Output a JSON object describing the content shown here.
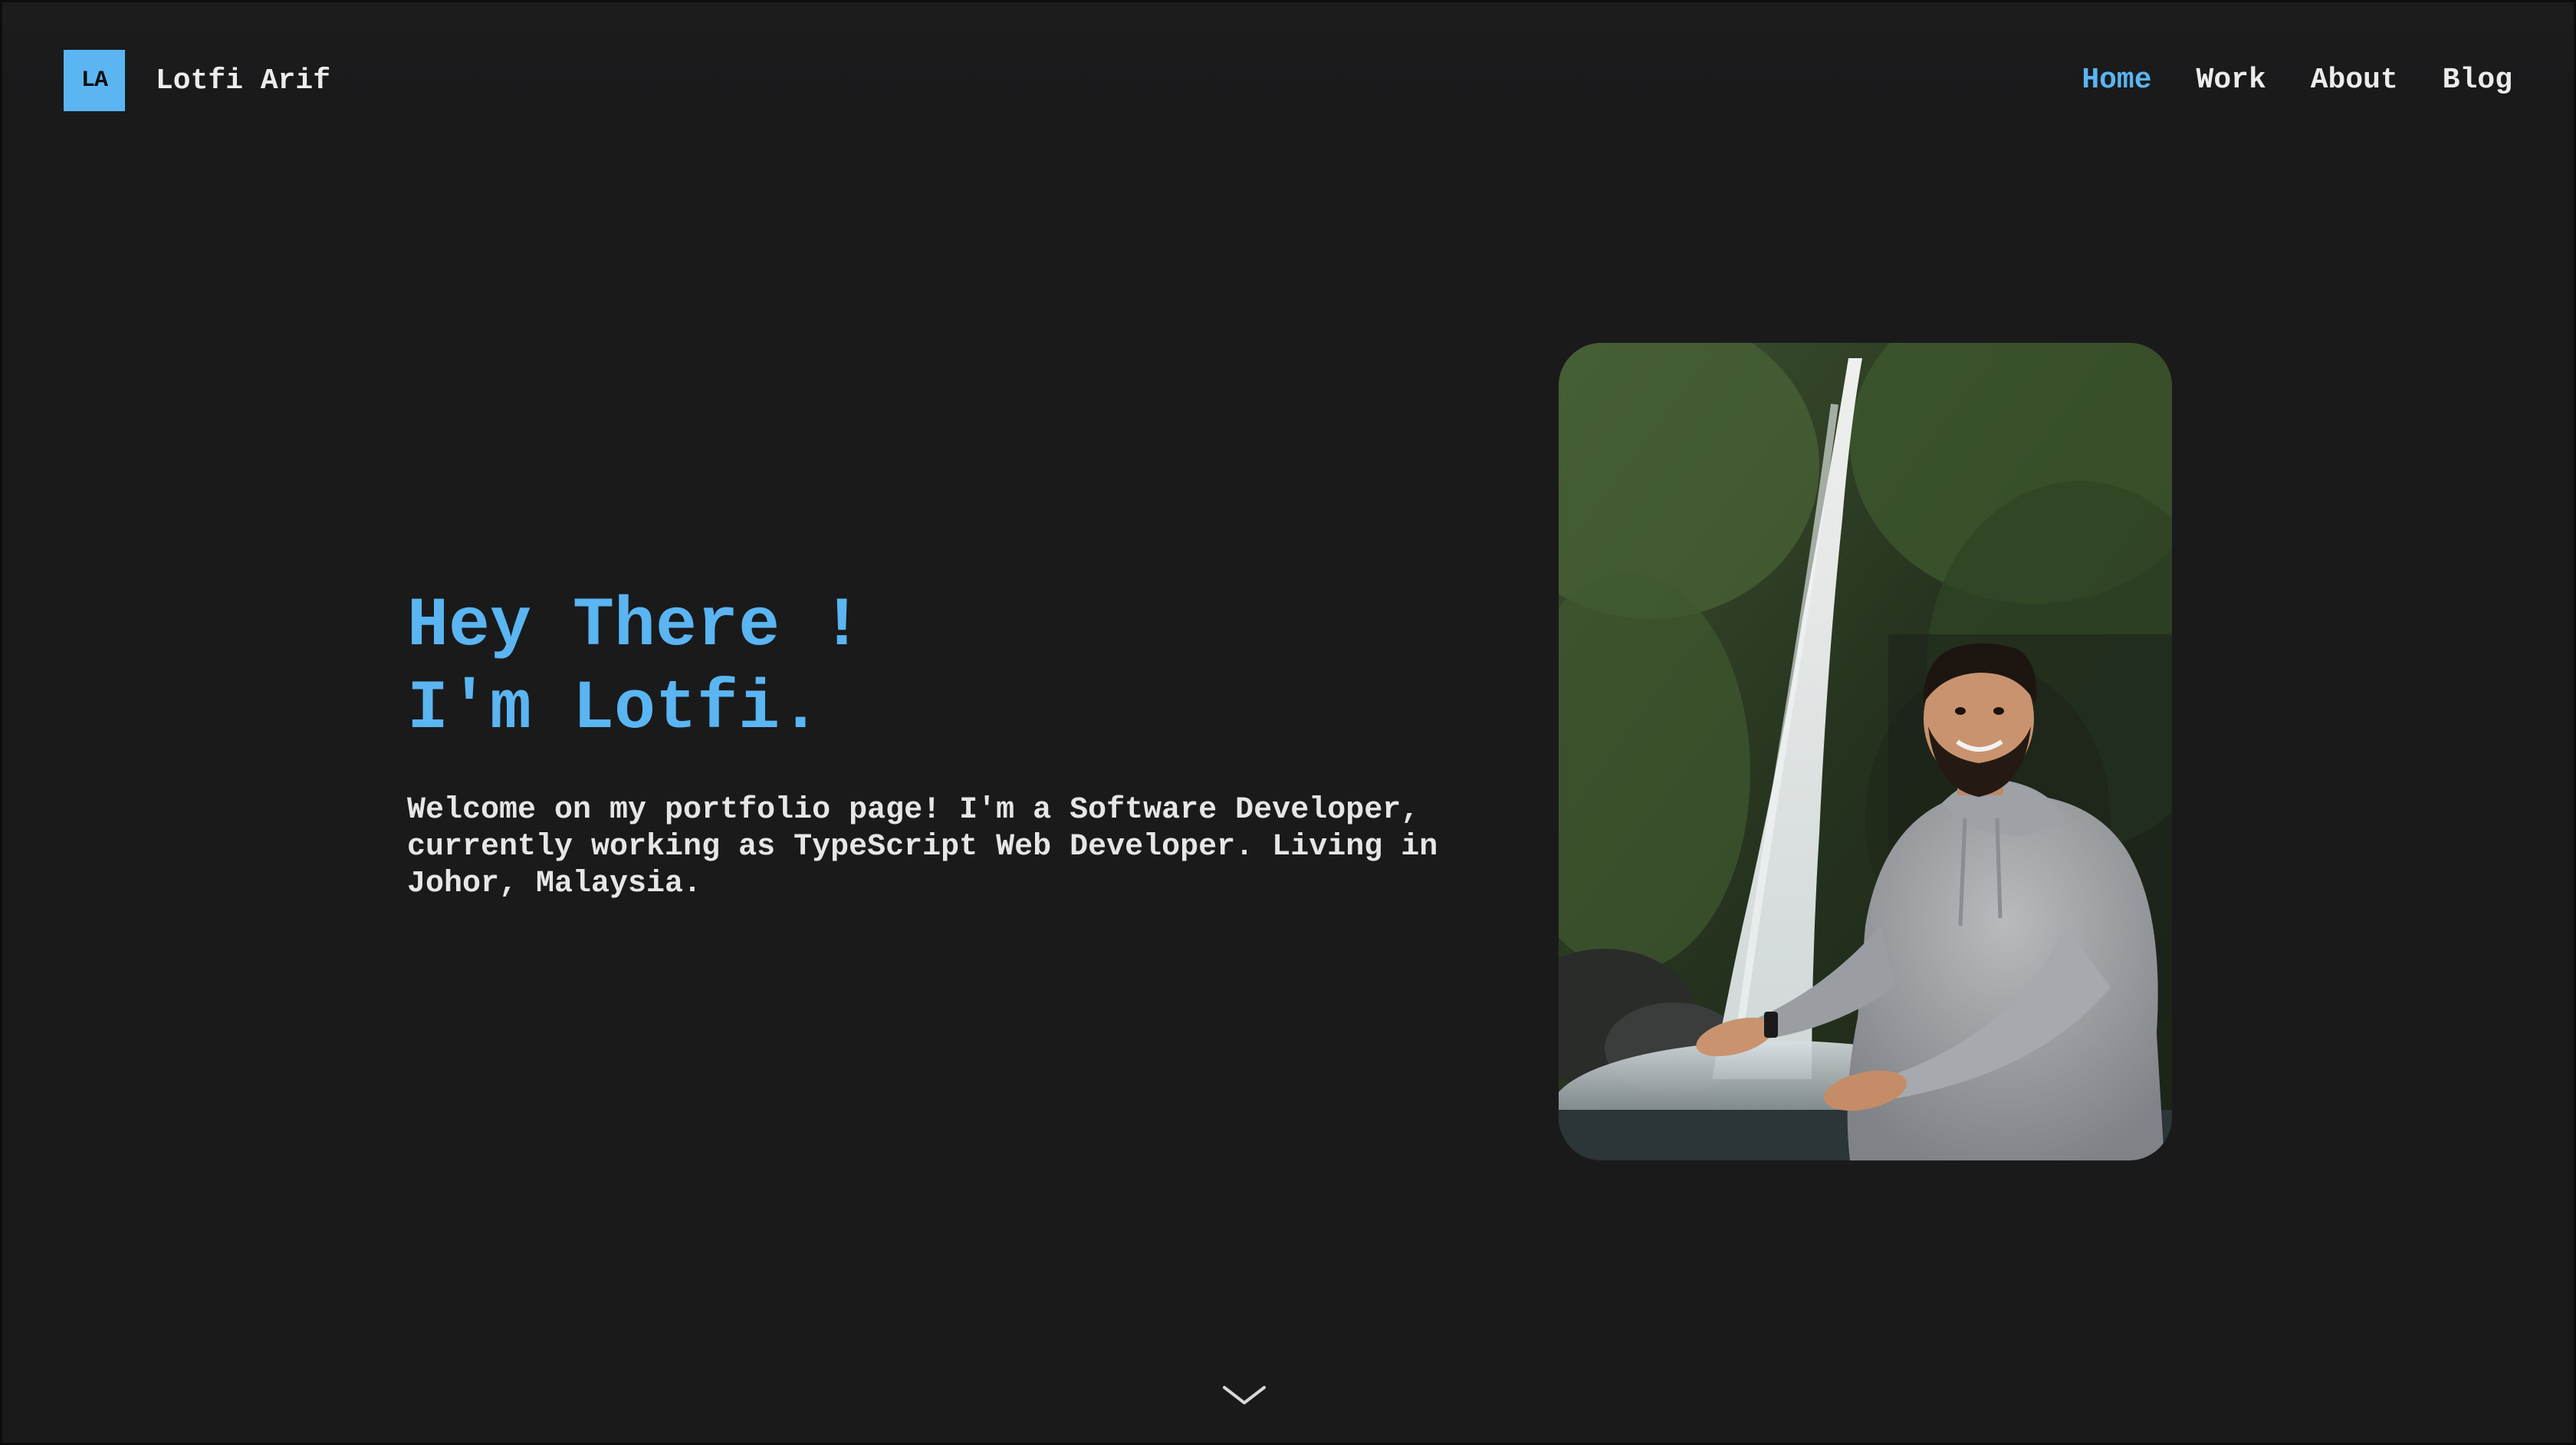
{
  "header": {
    "logo_initials": "LA",
    "brand_name": "Lotfi Arif",
    "nav": [
      {
        "label": "Home",
        "active": true
      },
      {
        "label": "Work",
        "active": false
      },
      {
        "label": "About",
        "active": false
      },
      {
        "label": "Blog",
        "active": false
      }
    ]
  },
  "hero": {
    "greeting_line1": "Hey There !",
    "greeting_line2": "I'm Lotfi.",
    "description": "Welcome on my portfolio page! I'm a Software Developer, currently working as TypeScript Web Developer. Living in Johor, Malaysia."
  },
  "photo": {
    "icon": "portrait-photo"
  },
  "scroll": {
    "icon": "chevron-down-icon"
  },
  "colors": {
    "background": "#1a1a1b",
    "accent": "#5ab5f2",
    "text": "#ececec"
  }
}
